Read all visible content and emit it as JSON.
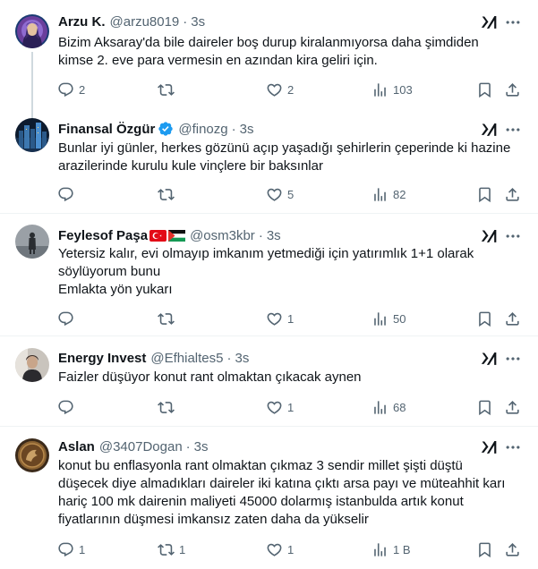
{
  "tweets": [
    {
      "name": "Arzu K.",
      "handle": "@arzu8019",
      "dot": "·",
      "time": "3s",
      "lines": [
        "Bizim Aksaray'da bile daireler boş durup kiralanmıyorsa daha şimdiden",
        "kimse 2. eve para vermesin en azından kira geliri için."
      ],
      "replies": "2",
      "retweets": "",
      "likes": "2",
      "views": "103",
      "avatar": "mystic-woman-avatar"
    },
    {
      "name": "Finansal Özgür",
      "handle": "@finozg",
      "dot": "·",
      "time": "3s",
      "verified": true,
      "lines": [
        "Bunlar iyi günler, herkes gözünü açıp yaşadığı şehirlerin çeperinde ki hazine",
        "arazilerinde kurulu kule vinçlere bir baksınlar"
      ],
      "replies": "",
      "retweets": "",
      "likes": "5",
      "views": "82",
      "avatar": "city-night-avatar"
    },
    {
      "name": "Feylesof Paşa",
      "flags": [
        "turkey-flag-icon",
        "palestine-flag-icon"
      ],
      "handle": "@osm3kbr",
      "dot": "·",
      "time": "3s",
      "lines": [
        "Yetersiz kalır, evi olmayıp imkanım yetmediği için yatırımlık 1+1 olarak",
        "söylüyorum bunu",
        "Emlakta yön yukarı"
      ],
      "replies": "",
      "retweets": "",
      "likes": "1",
      "views": "50",
      "avatar": "foggy-figure-avatar"
    },
    {
      "name": "Energy Invest",
      "handle": "@Efhialtes5",
      "dot": "·",
      "time": "3s",
      "lines": [
        "Faizler düşüyor konut rant olmaktan çıkacak aynen"
      ],
      "replies": "",
      "retweets": "",
      "likes": "1",
      "views": "68",
      "avatar": "person-portrait-avatar"
    },
    {
      "name": "Aslan",
      "handle": "@3407Dogan",
      "dot": "·",
      "time": "3s",
      "lines": [
        "konut bu enflasyonla rant olmaktan çıkmaz 3 sendir millet şişti düştü",
        "düşecek diye almadıkları daireler iki katına çıktı arsa payı ve müteahhit karı",
        "hariç 100 mk dairenin maliyeti 45000 dolarmış istanbulda artık konut",
        "fiyatlarının düşmesi imkansız zaten daha da yükselir"
      ],
      "replies": "1",
      "retweets": "1",
      "likes": "1",
      "views": "1 B",
      "avatar": "coin-emblem-avatar"
    }
  ],
  "colors": {
    "text": "#0f1419",
    "secondary": "#536471",
    "verified": "#1d9bf0",
    "border": "#eff3f4"
  }
}
